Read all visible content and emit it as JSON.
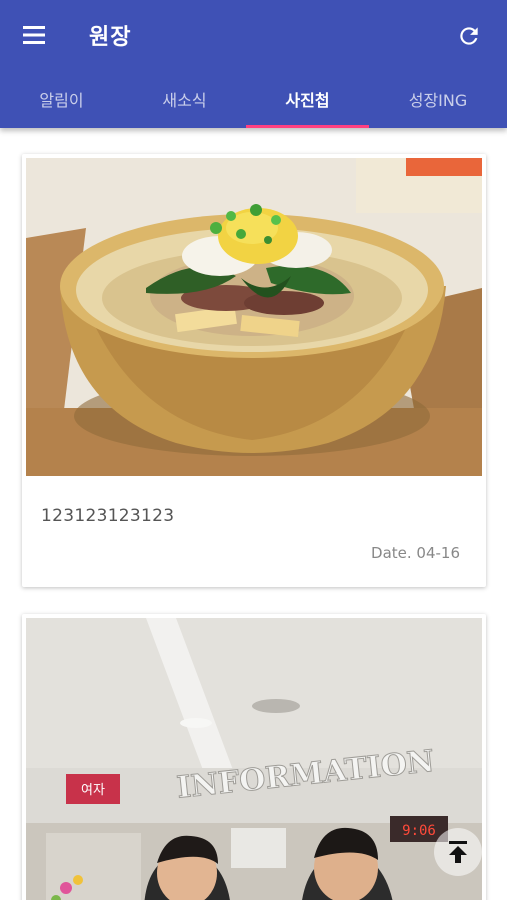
{
  "app": {
    "title": "원장"
  },
  "toolbar": {
    "menu_icon": "menu-icon",
    "refresh_icon": "refresh-icon"
  },
  "tabs": [
    {
      "label": "알림이",
      "active": false
    },
    {
      "label": "새소식",
      "active": false
    },
    {
      "label": "사진첩",
      "active": true
    },
    {
      "label": "성장ING",
      "active": false
    }
  ],
  "posts": [
    {
      "caption": "123123123123",
      "date": "Date. 04-16",
      "photo": "bowl-of-cold-noodles"
    },
    {
      "caption": "",
      "date": "",
      "photo": "two-men-at-information-desk",
      "sign_text": "INFORMATION",
      "sign_small": "여자",
      "clock_text": "9:06"
    }
  ],
  "scroll_top_icon": "scroll-to-top-icon",
  "colors": {
    "primary": "#3f51b5",
    "accent": "#ff4081"
  }
}
